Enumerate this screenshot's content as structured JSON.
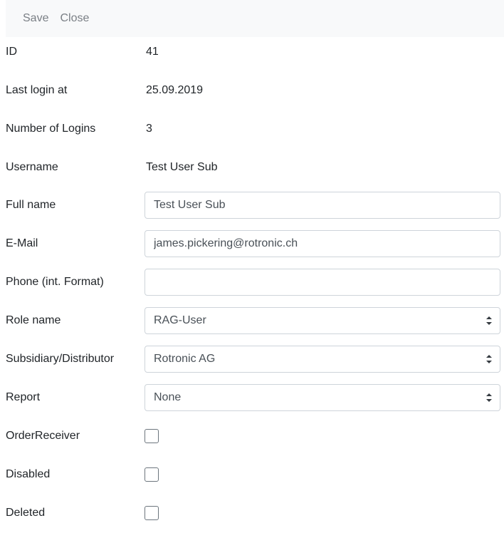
{
  "toolbar": {
    "save_label": "Save",
    "close_label": "Close"
  },
  "fields": {
    "id": {
      "label": "ID",
      "value": "41"
    },
    "last_login": {
      "label": "Last login at",
      "value": "25.09.2019"
    },
    "logins": {
      "label": "Number of Logins",
      "value": "3"
    },
    "username": {
      "label": "Username",
      "value": "Test User Sub"
    },
    "full_name": {
      "label": "Full name",
      "value": "Test User Sub"
    },
    "email": {
      "label": "E-Mail",
      "value": "james.pickering@rotronic.ch"
    },
    "phone": {
      "label": "Phone (int. Format)",
      "value": ""
    },
    "role": {
      "label": "Role name",
      "value": "RAG-User"
    },
    "subsidiary": {
      "label": "Subsidiary/Distributor",
      "value": "Rotronic AG"
    },
    "report": {
      "label": "Report",
      "value": "None"
    },
    "order_receiver": {
      "label": "OrderReceiver",
      "checked": false
    },
    "disabled": {
      "label": "Disabled",
      "checked": false
    },
    "deleted": {
      "label": "Deleted",
      "checked": false
    }
  },
  "colors": {
    "toolbar_bg": "#f8f9fa",
    "toolbar_text": "#7a7f85",
    "border": "#ced4da",
    "text": "#212529"
  }
}
